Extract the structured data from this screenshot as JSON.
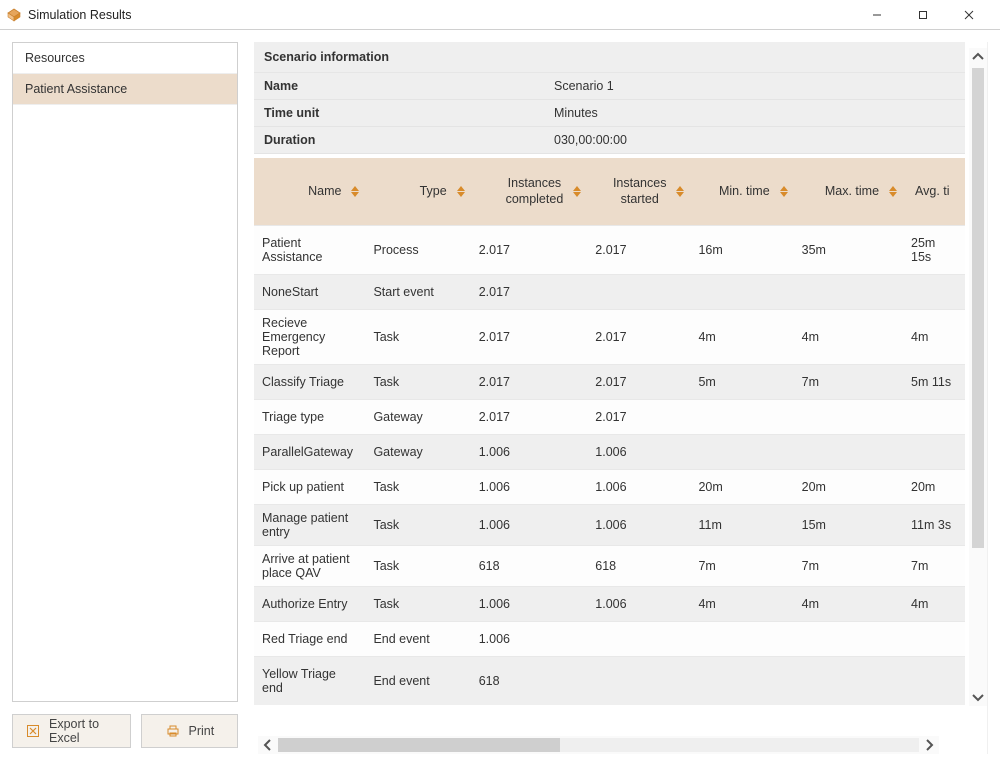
{
  "window": {
    "title": "Simulation Results"
  },
  "sidebar": {
    "items": [
      {
        "label": "Resources",
        "selected": false
      },
      {
        "label": "Patient Assistance",
        "selected": true
      }
    ]
  },
  "buttons": {
    "export": "Export to Excel",
    "print": "Print"
  },
  "scenario": {
    "header": "Scenario information",
    "rows": [
      {
        "label": "Name",
        "value": "Scenario 1"
      },
      {
        "label": "Time unit",
        "value": "Minutes"
      },
      {
        "label": "Duration",
        "value": "030,00:00:00"
      }
    ]
  },
  "table": {
    "headers": {
      "name": "Name",
      "type": "Type",
      "instances_completed_l1": "Instances",
      "instances_completed_l2": "completed",
      "instances_started_l1": "Instances",
      "instances_started_l2": "started",
      "min_time": "Min. time",
      "max_time": "Max. time",
      "avg_time": "Avg. ti"
    },
    "rows": [
      {
        "name": "Patient Assistance",
        "type": "Process",
        "ic": "2.017",
        "is": "2.017",
        "min": "16m",
        "max": "35m",
        "avg": "25m 15s"
      },
      {
        "name": "NoneStart",
        "type": "Start event",
        "ic": "2.017",
        "is": "",
        "min": "",
        "max": "",
        "avg": ""
      },
      {
        "name": "Recieve Emergency Report",
        "type": "Task",
        "ic": "2.017",
        "is": "2.017",
        "min": "4m",
        "max": "4m",
        "avg": "4m",
        "two": true
      },
      {
        "name": "Classify Triage",
        "type": "Task",
        "ic": "2.017",
        "is": "2.017",
        "min": "5m",
        "max": "7m",
        "avg": "5m 11s"
      },
      {
        "name": "Triage type",
        "type": "Gateway",
        "ic": "2.017",
        "is": "2.017",
        "min": "",
        "max": "",
        "avg": ""
      },
      {
        "name": "ParallelGateway",
        "type": "Gateway",
        "ic": "1.006",
        "is": "1.006",
        "min": "",
        "max": "",
        "avg": ""
      },
      {
        "name": "Pick up patient",
        "type": "Task",
        "ic": "1.006",
        "is": "1.006",
        "min": "20m",
        "max": "20m",
        "avg": "20m"
      },
      {
        "name": "Manage patient entry",
        "type": "Task",
        "ic": "1.006",
        "is": "1.006",
        "min": "11m",
        "max": "15m",
        "avg": "11m 3s",
        "two": true
      },
      {
        "name": "Arrive at patient place QAV",
        "type": "Task",
        "ic": "618",
        "is": "618",
        "min": "7m",
        "max": "7m",
        "avg": "7m",
        "two": true
      },
      {
        "name": "Authorize Entry",
        "type": "Task",
        "ic": "1.006",
        "is": "1.006",
        "min": "4m",
        "max": "4m",
        "avg": "4m"
      },
      {
        "name": "Red Triage end",
        "type": "End event",
        "ic": "1.006",
        "is": "",
        "min": "",
        "max": "",
        "avg": ""
      },
      {
        "name": "Yellow Triage end",
        "type": "End event",
        "ic": "618",
        "is": "",
        "min": "",
        "max": "",
        "avg": ""
      }
    ]
  }
}
